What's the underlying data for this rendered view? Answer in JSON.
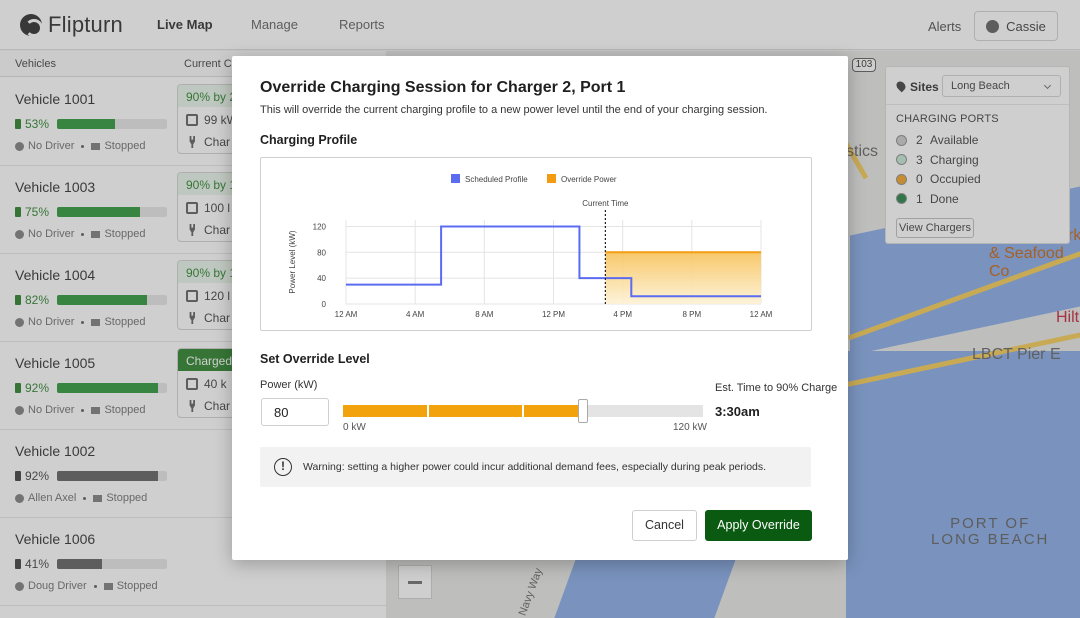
{
  "app": {
    "brand": "Flipturn",
    "nav": [
      "Live Map",
      "Manage",
      "Reports"
    ],
    "alerts": "Alerts",
    "user": "Cassie"
  },
  "vehicles_panel": {
    "col_vehicles": "Vehicles",
    "col_current": "Current Ch",
    "vehicles": [
      {
        "name": "Vehicle 1001",
        "pct": "53%",
        "driver": "No Driver",
        "status": "Stopped",
        "charge_fraction": 0.53,
        "card_top": "90% by 2",
        "card_power": "99 kW",
        "card_charger": "Char",
        "charging": true
      },
      {
        "name": "Vehicle 1003",
        "pct": "75%",
        "driver": "No Driver",
        "status": "Stopped",
        "charge_fraction": 0.75,
        "card_top": "90% by 1",
        "card_power": "100 l",
        "card_charger": "Char",
        "charging": true
      },
      {
        "name": "Vehicle 1004",
        "pct": "82%",
        "driver": "No Driver",
        "status": "Stopped",
        "charge_fraction": 0.82,
        "card_top": "90% by 1",
        "card_power": "120 l",
        "card_charger": "Char",
        "charging": true
      },
      {
        "name": "Vehicle 1005",
        "pct": "92%",
        "driver": "No Driver",
        "status": "Stopped",
        "charge_fraction": 0.92,
        "card_top": "Charged",
        "card_power": "40 k",
        "card_charger": "Char",
        "charging": true
      },
      {
        "name": "Vehicle 1002",
        "pct": "92%",
        "driver": "Allen Axel",
        "status": "Stopped",
        "charge_fraction": 0.92,
        "charging": false
      },
      {
        "name": "Vehicle 1006",
        "pct": "41%",
        "driver": "Doug Driver",
        "status": "Stopped",
        "charge_fraction": 0.41,
        "charging": false
      }
    ]
  },
  "map": {
    "highway": "103",
    "labels": [
      "stics",
      "rk",
      "& Seafood Co",
      "Hilt",
      "LBCT Pier E"
    ],
    "port_label_line1": "PORT OF",
    "port_label_line2": "LONG BEACH",
    "street": "Navy Way"
  },
  "sites": {
    "label": "Sites",
    "selected": "Long Beach",
    "section_title": "CHARGING PORTS",
    "ports": [
      {
        "count": "2",
        "label": "Available",
        "color": "#c8c8c8"
      },
      {
        "count": "3",
        "label": "Charging",
        "color": "#bfe6cf"
      },
      {
        "count": "0",
        "label": "Occupied",
        "color": "#f39c12"
      },
      {
        "count": "1",
        "label": "Done",
        "color": "#157a3a"
      }
    ],
    "view_button": "View Chargers"
  },
  "modal": {
    "title": "Override Charging Session for Charger 2, Port 1",
    "subtitle": "This will override the current charging profile to a new power level until the end of your charging session.",
    "profile_heading": "Charging Profile",
    "override_heading": "Set Override Level",
    "power_label": "Power (kW)",
    "power_value": "80",
    "slider_min_label": "0 kW",
    "slider_max_label": "120 kW",
    "slider_min": 0,
    "slider_max": 120,
    "slider_value": 80,
    "est_label": "Est. Time to 90% Charge",
    "est_value": "3:30am",
    "warning": "Warning: setting a higher power could incur additional demand fees, especially during peak periods.",
    "cancel": "Cancel",
    "apply": "Apply Override"
  },
  "chart_data": {
    "type": "line",
    "ylabel": "Power Level (kW)",
    "xlabel": "",
    "x_ticks": [
      "12 AM",
      "4 AM",
      "8 AM",
      "12 PM",
      "4 PM",
      "8 PM",
      "12 AM"
    ],
    "x_range_hours": [
      0,
      24
    ],
    "y_ticks": [
      0,
      40,
      80,
      120
    ],
    "ylim": [
      0,
      130
    ],
    "grid": true,
    "legend_position": "top",
    "annotation": {
      "label": "Current Time",
      "x_hour": 15
    },
    "series": [
      {
        "name": "Scheduled Profile",
        "color": "#5b6cf0",
        "steps": [
          {
            "x": 0,
            "y": 30
          },
          {
            "x": 5.5,
            "y": 120
          },
          {
            "x": 13.5,
            "y": 40
          },
          {
            "x": 16.5,
            "y": 12
          },
          {
            "x": 24,
            "y": 12
          }
        ]
      },
      {
        "name": "Override Power",
        "color": "#f39c12",
        "steps": [
          {
            "x": 15,
            "y": 80
          },
          {
            "x": 24,
            "y": 80
          }
        ]
      }
    ]
  }
}
